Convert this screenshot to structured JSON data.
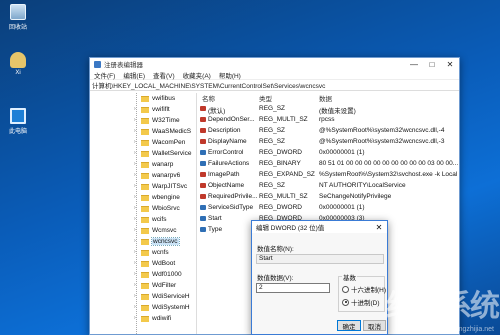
{
  "desktop": {
    "icons": [
      {
        "label": "回收站",
        "icon": "recycle-bin-icon"
      },
      {
        "label": "Xi",
        "icon": "user-folder-icon"
      },
      {
        "label": "此电脑",
        "icon": "computer-icon"
      }
    ]
  },
  "window": {
    "title": "注册表编辑器",
    "menu": [
      "文件(F)",
      "编辑(E)",
      "查看(V)",
      "收藏夹(A)",
      "帮助(H)"
    ],
    "address": "计算机\\HKEY_LOCAL_MACHINE\\SYSTEM\\CurrentControlSet\\Services\\wcncsvc"
  },
  "tree": {
    "items": [
      {
        "label": "vwifibus",
        "expandable": false
      },
      {
        "label": "vwififlt",
        "expandable": true
      },
      {
        "label": "W32Time",
        "expandable": true
      },
      {
        "label": "WaaSMedicS",
        "expandable": true
      },
      {
        "label": "WacomPen",
        "expandable": true
      },
      {
        "label": "WalletService",
        "expandable": true
      },
      {
        "label": "wanarp",
        "expandable": true
      },
      {
        "label": "wanarpv6",
        "expandable": true
      },
      {
        "label": "WarpJITSvc",
        "expandable": true
      },
      {
        "label": "wbengine",
        "expandable": true
      },
      {
        "label": "WbioSrvc",
        "expandable": true
      },
      {
        "label": "wcifs",
        "expandable": true
      },
      {
        "label": "Wcmsvc",
        "expandable": true
      },
      {
        "label": "wcncsvc",
        "expandable": true,
        "selected": true
      },
      {
        "label": "wcnfs",
        "expandable": true
      },
      {
        "label": "WdBoot",
        "expandable": true
      },
      {
        "label": "Wdf01000",
        "expandable": true
      },
      {
        "label": "WdFilter",
        "expandable": true
      },
      {
        "label": "WdiServiceH",
        "expandable": true
      },
      {
        "label": "WdiSystemH",
        "expandable": true
      },
      {
        "label": "wdiwifi",
        "expandable": true
      }
    ]
  },
  "list": {
    "headers": {
      "name": "名称",
      "type": "类型",
      "data": "数据"
    },
    "rows": [
      {
        "name": "(默认)",
        "type": "REG_SZ",
        "data": "(数值未设置)",
        "kind": "sz"
      },
      {
        "name": "DependOnSer...",
        "type": "REG_MULTI_SZ",
        "data": "rpcss",
        "kind": "sz"
      },
      {
        "name": "Description",
        "type": "REG_SZ",
        "data": "@%SystemRoot%\\system32\\wcncsvc.dll,-4",
        "kind": "sz"
      },
      {
        "name": "DisplayName",
        "type": "REG_SZ",
        "data": "@%SystemRoot%\\system32\\wcncsvc.dll,-3",
        "kind": "sz"
      },
      {
        "name": "ErrorControl",
        "type": "REG_DWORD",
        "data": "0x00000001 (1)",
        "kind": "bin"
      },
      {
        "name": "FailureActions",
        "type": "REG_BINARY",
        "data": "80 51 01 00 00 00 00 00 00 00 00 00 03 00 00...",
        "kind": "bin"
      },
      {
        "name": "ImagePath",
        "type": "REG_EXPAND_SZ",
        "data": "%SystemRoot%\\System32\\svchost.exe -k Local",
        "kind": "sz"
      },
      {
        "name": "ObjectName",
        "type": "REG_SZ",
        "data": "NT AUTHORITY\\LocalService",
        "kind": "sz"
      },
      {
        "name": "RequiredPrivile...",
        "type": "REG_MULTI_SZ",
        "data": "SeChangeNotifyPrivilege",
        "kind": "sz"
      },
      {
        "name": "ServiceSidType",
        "type": "REG_DWORD",
        "data": "0x00000001 (1)",
        "kind": "bin"
      },
      {
        "name": "Start",
        "type": "REG_DWORD",
        "data": "0x00000003 (3)",
        "kind": "bin"
      },
      {
        "name": "Type",
        "type": "",
        "data": "",
        "kind": "bin"
      }
    ]
  },
  "dialog": {
    "title": "编辑 DWORD (32 位)值",
    "name_label": "数值名称(N):",
    "name_value": "Start",
    "data_label": "数值数据(V):",
    "data_value": "2",
    "base_label": "基数",
    "radio_hex": "十六进制(H)",
    "radio_dec": "十进制(D)",
    "ok": "确定",
    "cancel": "取消"
  },
  "watermark": {
    "main": "纯净系统",
    "sub": "www.xitongzhijia.net"
  },
  "colors": {
    "desktop": "#0a5cb8",
    "accent": "#0078d7",
    "selection": "#cce4f7"
  }
}
